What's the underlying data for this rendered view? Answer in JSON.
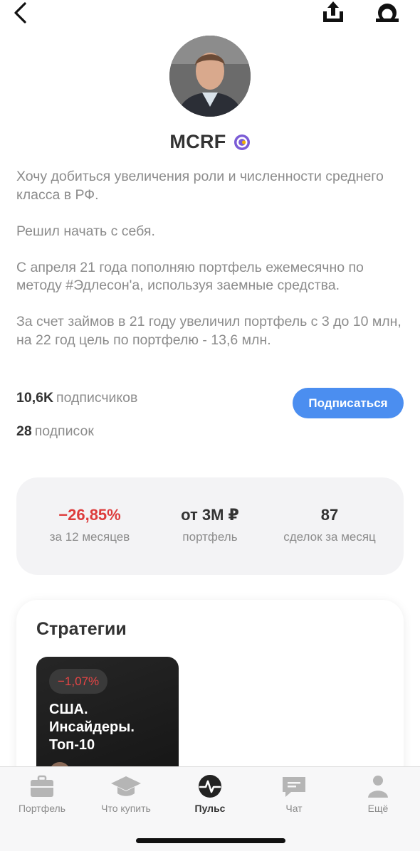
{
  "profile": {
    "name": "MCRF",
    "bio": [
      "Хочу добиться увеличения роли и численности среднего класса в РФ.",
      "Решил начать с себя.",
      "С апреля 21 года пополняю портфель ежемесячно по методу #Эдлесон'а, используя заемные средства.",
      "За счет займов в 21 году увеличил портфель с 3 до 10 млн, на 22 год цель по портфелю - 13,6 млн."
    ],
    "followers_count": "10,6K",
    "followers_label": "подписчиков",
    "following_count": "28",
    "following_label": "подписок",
    "subscribe_label": "Подписаться"
  },
  "stats": [
    {
      "value": "−26,85%",
      "label": "за 12 месяцев"
    },
    {
      "value": "от 3M ₽",
      "label": "портфель"
    },
    {
      "value": "87",
      "label": "сделок за месяц"
    }
  ],
  "strategies": {
    "title": "Стратегии",
    "cards": [
      {
        "change": "−1,07%",
        "title": "США. Инсайдеры. Топ-10"
      }
    ]
  },
  "tabs": [
    {
      "label": "Портфель",
      "icon": "briefcase-icon"
    },
    {
      "label": "Что купить",
      "icon": "graduation-cap-icon"
    },
    {
      "label": "Пульс",
      "icon": "pulse-icon"
    },
    {
      "label": "Чат",
      "icon": "chat-icon"
    },
    {
      "label": "Ещё",
      "icon": "more-icon"
    }
  ],
  "colors": {
    "accent": "#4b8ef0",
    "negative": "#dd3b3b",
    "verified": "#7b5cd6",
    "text": "#333333",
    "muted": "#8c8c8c"
  }
}
